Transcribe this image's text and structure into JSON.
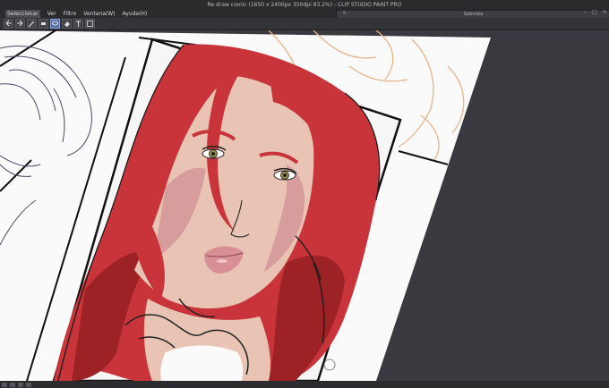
{
  "window": {
    "title": "Re draw comic (1650 x 2400px 350dpi 83.2%) - CLIP STUDIO PAINT PRO"
  },
  "menu": {
    "items": [
      "Seleccionar",
      "Ver",
      "Filtro",
      "Ventana(W)",
      "Ayuda(H)"
    ]
  },
  "subwindow": {
    "title": "Subvista"
  },
  "toolbar": {
    "tools": [
      "undo-icon",
      "redo-icon",
      "pen-icon",
      "eraser-icon",
      "lasso-icon",
      "fill-icon",
      "text-icon",
      "transform-icon"
    ],
    "selected_tool": "pen-icon"
  },
  "colors": {
    "hair": "#c8343a",
    "hair_dark": "#9c2226",
    "skin": "#e9c3b3",
    "skin_shadow": "#d69d9c",
    "lips": "#d98f96",
    "iris": "#8f8a4a",
    "canvas_bg": "#3b3940",
    "paper": "#fafafa",
    "sketch_orange": "#e7b48c"
  }
}
